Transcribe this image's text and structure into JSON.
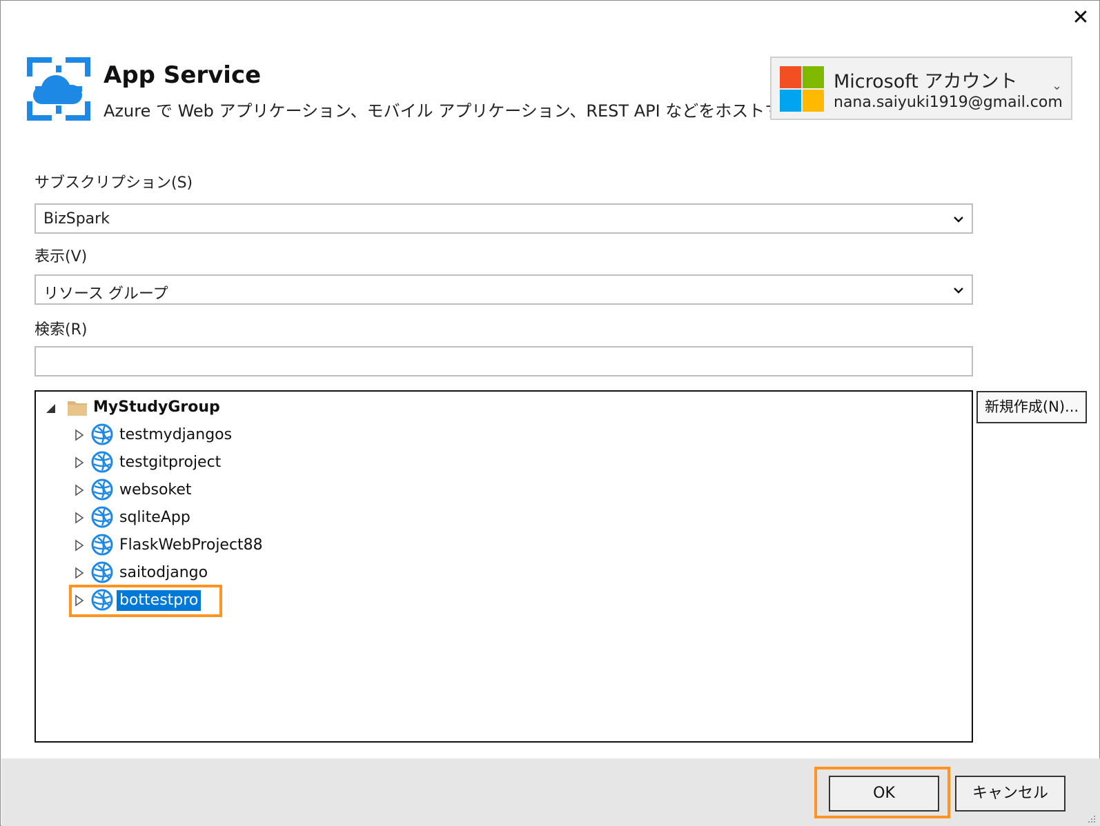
{
  "header": {
    "title": "App Service",
    "subtitle": "Azure で Web アプリケーション、モバイル アプリケーション、REST API などをホストする"
  },
  "close_icon_glyph": "✕",
  "account": {
    "provider": "Microsoft アカウント",
    "email": "nana.saiyuki1919@gmail.com",
    "chevron": "⌄",
    "logo_colors": [
      "#f25022",
      "#7fba00",
      "#00a4ef",
      "#ffb900"
    ]
  },
  "form": {
    "subscription_label": "サブスクリプション(S)",
    "subscription_value": "BizSpark",
    "view_label": "表示(V)",
    "view_value": "リソース グループ",
    "search_label": "検索(R)",
    "search_value": ""
  },
  "tree": {
    "group": "MyStudyGroup",
    "group_expanded": true,
    "items": [
      {
        "label": "testmydjangos"
      },
      {
        "label": "testgitproject"
      },
      {
        "label": "websoket"
      },
      {
        "label": "sqliteApp"
      },
      {
        "label": "FlaskWebProject88"
      },
      {
        "label": "saitodjango"
      },
      {
        "label": "bottestpro",
        "selected": true
      }
    ]
  },
  "buttons": {
    "new_label": "新規作成(N)...",
    "ok_label": "OK",
    "cancel_label": "キャンセル"
  },
  "colors": {
    "selection": "#0078d7",
    "highlight": "#ff9422",
    "azure_blue": "#1e88e5"
  },
  "icons": {
    "app_logo": "azure-app-service-icon",
    "group_icon": "folder-icon",
    "item_icon": "web-app-globe-icon",
    "expander_open": "triangle-down-icon",
    "expander_closed": "triangle-right-icon",
    "combo_arrow": "chevron-down-icon"
  }
}
